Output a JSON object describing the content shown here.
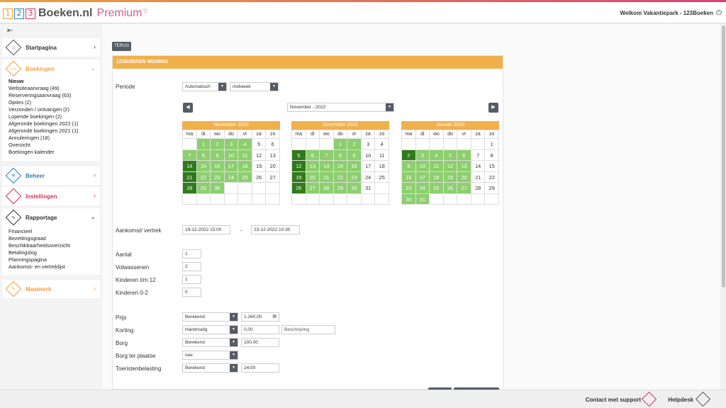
{
  "header": {
    "logo_digits": [
      "1",
      "2",
      "3"
    ],
    "logo_text": "Boeken.nl",
    "logo_premium": "Premium",
    "welcome": "Welkom Vakantiepark - 123Boeken"
  },
  "sidebar": {
    "sections": [
      {
        "title": "Startpagina",
        "color": "#555555"
      },
      {
        "title": "Boekingen",
        "color": "#f0a040",
        "items": [
          "Nieuw",
          "Websiteaanvraag (49)",
          "Reserveringsaanvraag (63)",
          "Opties (2)",
          "Verzonden / ontvangen (2)",
          "Lopende boekingen (2)",
          "Afgeronde boekingen 2022 (1)",
          "Afgeronde boekingen 2021 (1)",
          "Annuleringen (18)",
          "Overzicht",
          "Boekingen kalender"
        ]
      },
      {
        "title": "Beheer",
        "color": "#2a7fc1"
      },
      {
        "title": "Instellingen",
        "color": "#d6315b"
      },
      {
        "title": "Rapportage",
        "color": "#333333",
        "items": [
          "Financieel",
          "Bezettingsgraad",
          "Beschikbaarheidsoverzicht",
          "Betalingslog",
          "Planningspagina",
          "Aankomst- en vertreklijst"
        ]
      },
      {
        "title": "Maatwerk",
        "color": "#f0a040"
      }
    ]
  },
  "main": {
    "back_label": "TERUG",
    "panel_title": "123BOEKEN WONING",
    "periode_label": "Periode",
    "periode_mode": "Automatisch",
    "periode_type": "midweek",
    "month_select": "November - 2022",
    "weekdays": [
      "ma",
      "di",
      "wo",
      "do",
      "vr",
      "za",
      "zo"
    ],
    "calendars": [
      {
        "title": "November 2022"
      },
      {
        "title": "December 2022"
      },
      {
        "title": "Januari 2023"
      }
    ],
    "aankomst_label": "Aankomst/ vertrek",
    "aankomst": "19-12-2022 15:00",
    "dash": "-",
    "vertrek": "23-12-2022 10:30",
    "aantal_label": "Aantal",
    "aantal": "1",
    "volwassenen_label": "Volwassenen",
    "volwassenen": "2",
    "kinderen12_label": "Kinderen t/m 12",
    "kinderen12": "1",
    "kinderen02_label": "Kinderen 0-2",
    "kinderen02": "0",
    "prijs_label": "Prijs",
    "prijs_mode": "Berekend",
    "prijs": "1.260,00",
    "korting_label": "Korting",
    "korting_mode": "Handmatig",
    "korting": "0,00",
    "korting_desc_placeholder": "Beschrijving",
    "borg_label": "Borg",
    "borg_mode": "Berekend",
    "borg": "100,00",
    "borg_ter_plaatse_label": "Borg ter plaatse",
    "borg_ter_plaatse": "nee",
    "toeristen_label": "Toeristenbelasting",
    "toeristen_mode": "Berekend",
    "toeristen": "24,00"
  },
  "footer": {
    "contact": "Contact met support",
    "help": "Helpdesk"
  }
}
